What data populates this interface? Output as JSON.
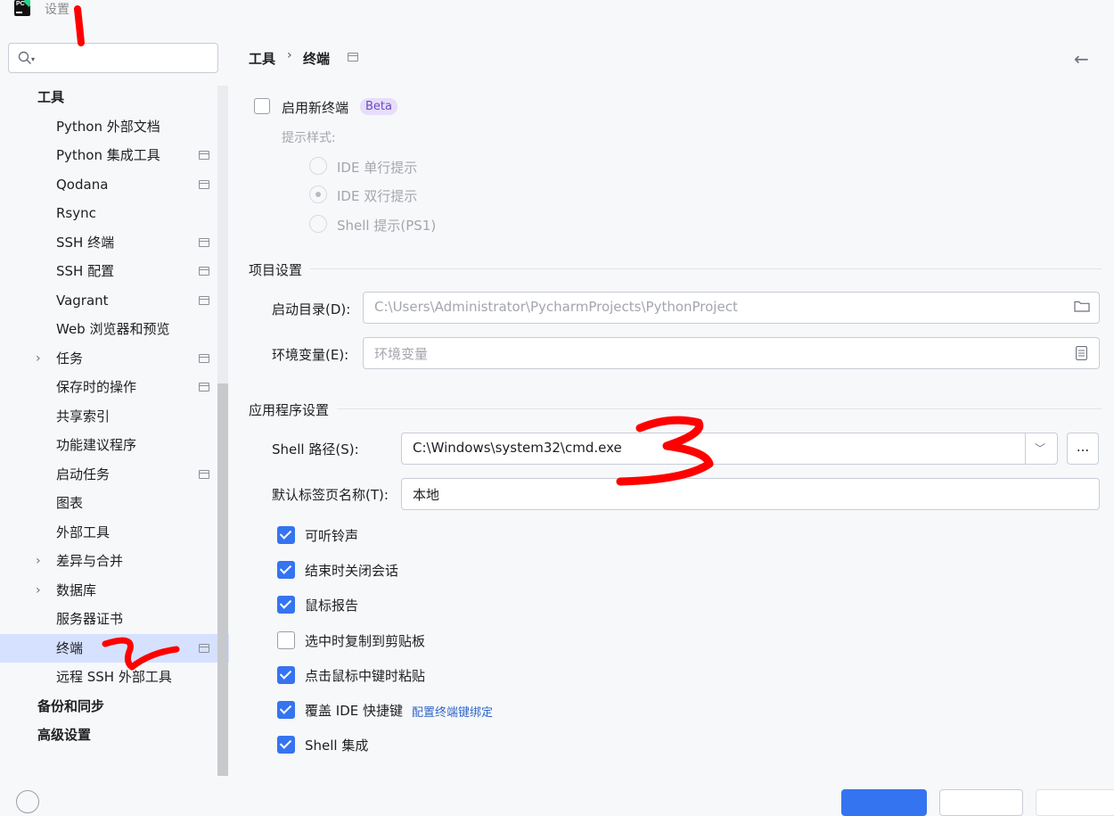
{
  "window": {
    "title": "设置"
  },
  "search": {
    "placeholder": ""
  },
  "sidebar": {
    "items": [
      {
        "label": "工具",
        "level": 0,
        "pinned": false,
        "chevron": false
      },
      {
        "label": "Python 外部文档",
        "level": 1,
        "pinned": false,
        "chevron": false
      },
      {
        "label": "Python 集成工具",
        "level": 1,
        "pinned": true,
        "chevron": false
      },
      {
        "label": "Qodana",
        "level": 1,
        "pinned": true,
        "chevron": false
      },
      {
        "label": "Rsync",
        "level": 1,
        "pinned": false,
        "chevron": false
      },
      {
        "label": "SSH 终端",
        "level": 1,
        "pinned": true,
        "chevron": false
      },
      {
        "label": "SSH 配置",
        "level": 1,
        "pinned": true,
        "chevron": false
      },
      {
        "label": "Vagrant",
        "level": 1,
        "pinned": true,
        "chevron": false
      },
      {
        "label": "Web 浏览器和预览",
        "level": 1,
        "pinned": false,
        "chevron": false
      },
      {
        "label": "任务",
        "level": 1,
        "pinned": true,
        "chevron": true
      },
      {
        "label": "保存时的操作",
        "level": 1,
        "pinned": true,
        "chevron": false
      },
      {
        "label": "共享索引",
        "level": 1,
        "pinned": false,
        "chevron": false
      },
      {
        "label": "功能建议程序",
        "level": 1,
        "pinned": false,
        "chevron": false
      },
      {
        "label": "启动任务",
        "level": 1,
        "pinned": true,
        "chevron": false
      },
      {
        "label": "图表",
        "level": 1,
        "pinned": false,
        "chevron": false
      },
      {
        "label": "外部工具",
        "level": 1,
        "pinned": false,
        "chevron": false
      },
      {
        "label": "差异与合并",
        "level": 1,
        "pinned": false,
        "chevron": true
      },
      {
        "label": "数据库",
        "level": 1,
        "pinned": false,
        "chevron": true
      },
      {
        "label": "服务器证书",
        "level": 1,
        "pinned": false,
        "chevron": false
      },
      {
        "label": "终端",
        "level": 1,
        "pinned": true,
        "chevron": false,
        "selected": true
      },
      {
        "label": "远程 SSH 外部工具",
        "level": 1,
        "pinned": false,
        "chevron": false
      },
      {
        "label": "备份和同步",
        "level": 0,
        "pinned": false,
        "chevron": false
      },
      {
        "label": "高级设置",
        "level": 0,
        "pinned": false,
        "chevron": false
      }
    ]
  },
  "breadcrumb": {
    "parent": "工具",
    "separator": "›",
    "current": "终端"
  },
  "new_terminal": {
    "enable_label": "启用新终端",
    "enabled": false,
    "badge": "Beta",
    "prompt_style_label": "提示样式:",
    "options": [
      {
        "label": "IDE 单行提示",
        "selected": false
      },
      {
        "label": "IDE 双行提示",
        "selected": true
      },
      {
        "label": "Shell 提示(PS1)",
        "selected": false
      }
    ]
  },
  "project_settings": {
    "title": "项目设置",
    "start_dir_label": "启动目录(D):",
    "start_dir_placeholder": "C:\\Users\\Administrator\\PycharmProjects\\PythonProject",
    "env_label": "环境变量(E):",
    "env_placeholder": "环境变量"
  },
  "app_settings": {
    "title": "应用程序设置",
    "shell_path_label": "Shell 路径(S):",
    "shell_path": "C:\\Windows\\system32\\cmd.exe",
    "browse": "...",
    "tab_name_label": "默认标签页名称(T):",
    "tab_name": "本地",
    "checkboxes": [
      {
        "label": "可听铃声",
        "checked": true
      },
      {
        "label": "结束时关闭会话",
        "checked": true
      },
      {
        "label": "鼠标报告",
        "checked": true
      },
      {
        "label": "选中时复制到剪贴板",
        "checked": false
      },
      {
        "label": "点击鼠标中键时粘贴",
        "checked": true
      },
      {
        "label": "覆盖 IDE 快捷键",
        "checked": true,
        "link": "配置终端键绑定"
      },
      {
        "label": "Shell 集成",
        "checked": true
      }
    ]
  },
  "colors": {
    "accent": "#3574f0",
    "selection": "#d5e1ff",
    "annotation": "#ff0000",
    "link": "#2f65ca"
  }
}
